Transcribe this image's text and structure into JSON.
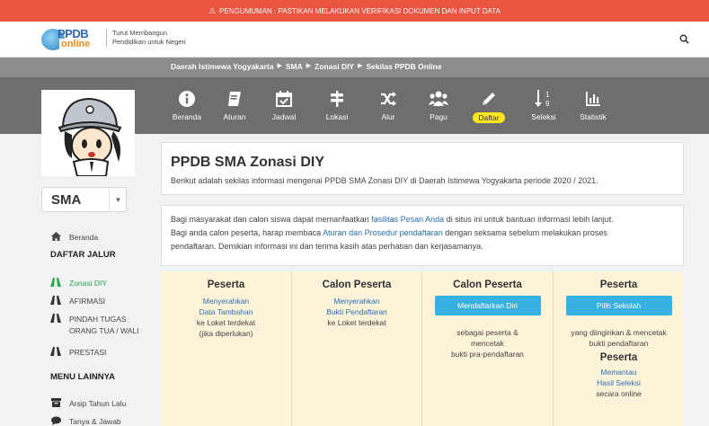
{
  "announcement": "PENGUMUMAN : PASTIKAN MELAKUKAN VERIFIKASI DOKUMEN DAN INPUT DATA",
  "brand": {
    "logo_main": "PPDB",
    "logo_sub": "online",
    "tagline_1": "Turut Membangun",
    "tagline_2": "Pendidikan untuk Negeri"
  },
  "breadcrumb": [
    "Daerah Istimewa Yogyakarta",
    "SMA",
    "Zonasi DIY",
    "Sekilas PPDB Online"
  ],
  "nav": [
    {
      "label": "Beranda",
      "icon": "info-icon"
    },
    {
      "label": "Aturan",
      "icon": "book-icon"
    },
    {
      "label": "Jadwal",
      "icon": "calendar-icon"
    },
    {
      "label": "Lokasi",
      "icon": "signpost-icon"
    },
    {
      "label": "Alur",
      "icon": "shuffle-icon"
    },
    {
      "label": "Pagu",
      "icon": "users-icon"
    },
    {
      "label": "Daftar",
      "icon": "pencil-icon"
    },
    {
      "label": "Seleksi",
      "icon": "sort-numeric-icon"
    },
    {
      "label": "Statistik",
      "icon": "bar-chart-icon"
    }
  ],
  "sidebar": {
    "level": "SMA",
    "home": "Beranda",
    "daftar_jalur": "DAFTAR JALUR",
    "jalur": [
      {
        "label": "Zonasi DIY"
      },
      {
        "label": "AFIRMASI"
      },
      {
        "label": "PINDAH TUGAS",
        "label2": "ORANG TUA / WALI"
      },
      {
        "label": "PRESTASI"
      }
    ],
    "menu_lainnya": "MENU LAINNYA",
    "menu": [
      {
        "label": "Arsip Tahun Lalu"
      },
      {
        "label": "Tanya & Jawab"
      }
    ]
  },
  "main": {
    "title": "PPDB SMA Zonasi DIY",
    "subtitle": "Berikut adalah sekilas informasi mengenai PPDB SMA Zonasi DIY di Daerah Istimewa Yogyakarta periode 2020 / 2021.",
    "info": {
      "p1a": "Bagi masyarakat dan calon siswa dapat memanfaatkan ",
      "p1link": "fasilitas Pesan Anda",
      "p1b": " di situs ini untuk bantuan informasi lebih lanjut.",
      "p2a": "Bagi anda calon peserta, harap membaca ",
      "p2link": "Aturan dan Prosedur pendaftaran",
      "p2b": " dengan seksama sebelum melakukan proses",
      "p3": "pendaftaran. Demikian informasi ini dan terima kasih atas perhatian dan kerjasamanya."
    },
    "steps": {
      "s1": {
        "heading": "Peserta",
        "link1": "Menyerahkan",
        "link2": "Data Tambahan",
        "text1": "ke Loket terdekat",
        "text2": "(jika diperlukan)"
      },
      "s2": {
        "heading": "Calon Peserta",
        "link1": "Menyerahkan",
        "link2": "Bukti Pendaftaran",
        "text1": "ke Loket terdekat"
      },
      "s3": {
        "heading": "Calon Peserta",
        "button": "Mendaftarkan Diri",
        "text1": "sebagai peserta &",
        "text2": "mencetak",
        "text3": "bukti pra-pendaftaran"
      },
      "s4": {
        "heading": "Peserta",
        "button": "Pilih Sekolah",
        "text1": "yang diinginkan & mencetak",
        "text2": "bukti pendaftaran",
        "heading2": "Peserta",
        "link1": "Memantau",
        "link2": "Hasil Seleksi",
        "text3": "secara online"
      }
    }
  },
  "colors": {
    "announce": "#ea5440",
    "nav_bg": "#6e6e6e",
    "crumb_bg": "#8c8c8c",
    "active_green": "#2fa84f",
    "button_blue": "#38b0e3",
    "highlight_yellow": "#ffe623",
    "steps_bg": "#fdf3d9"
  }
}
